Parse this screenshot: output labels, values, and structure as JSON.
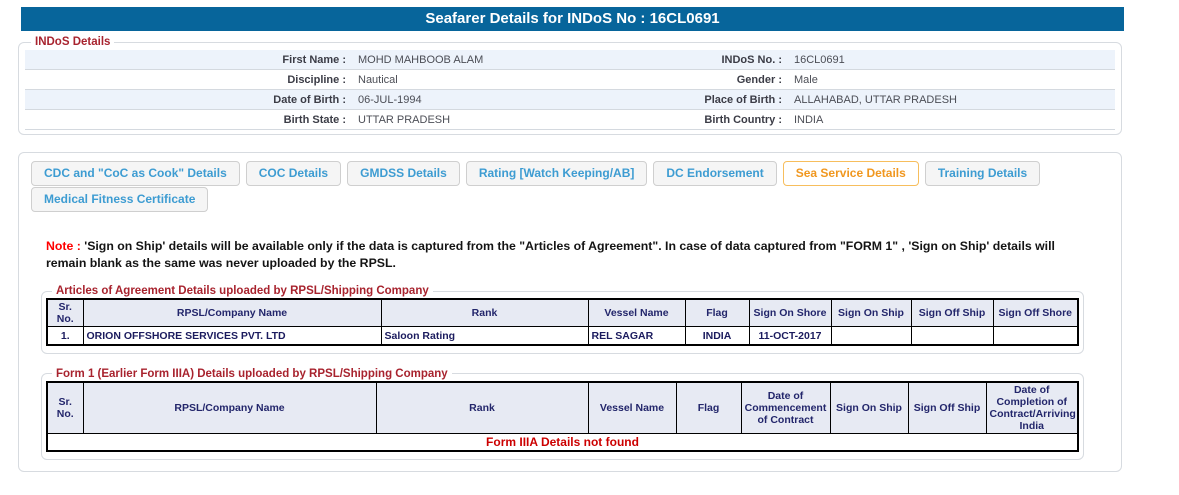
{
  "title": "Seafarer Details for INDoS No : 16CL0691",
  "indos_details": {
    "legend": "INDoS Details",
    "rows": [
      {
        "label1": "First Name :",
        "value1": "MOHD MAHBOOB ALAM",
        "label2": "INDoS No. :",
        "value2": "16CL0691"
      },
      {
        "label1": "Discipline :",
        "value1": "Nautical",
        "label2": "Gender :",
        "value2": "Male"
      },
      {
        "label1": "Date of Birth :",
        "value1": "06-JUL-1994",
        "label2": "Place of Birth :",
        "value2": "ALLAHABAD, UTTAR PRADESH"
      },
      {
        "label1": "Birth State :",
        "value1": "UTTAR PRADESH",
        "label2": "Birth Country :",
        "value2": "INDIA"
      }
    ]
  },
  "tabs": [
    {
      "label": "CDC and \"CoC as Cook\" Details",
      "row": 1,
      "active": false
    },
    {
      "label": "COC Details",
      "row": 1,
      "active": false
    },
    {
      "label": "GMDSS Details",
      "row": 1,
      "active": false
    },
    {
      "label": "Rating [Watch Keeping/AB]",
      "row": 1,
      "active": false
    },
    {
      "label": "DC Endorsement",
      "row": 1,
      "active": false
    },
    {
      "label": "Sea Service Details",
      "row": 1,
      "active": true
    },
    {
      "label": "Training Details",
      "row": 1,
      "active": false
    },
    {
      "label": "Medical Fitness Certificate",
      "row": 2,
      "active": false
    }
  ],
  "note": {
    "prefix": "Note :",
    "text": "'Sign on Ship' details will be available only if the data is captured from the \"Articles of Agreement\". In case of data captured from \"FORM 1\" , 'Sign on Ship' details will remain blank as the same was never uploaded by the RPSL."
  },
  "articles_table": {
    "legend": "Articles of Agreement Details uploaded by RPSL/Shipping Company",
    "headers": [
      "Sr. No.",
      "RPSL/Company Name",
      "Rank",
      "Vessel Name",
      "Flag",
      "Sign On Shore",
      "Sign On Ship",
      "Sign Off Ship",
      "Sign Off Shore"
    ],
    "rows": [
      [
        "1.",
        "ORION OFFSHORE SERVICES PVT. LTD",
        "Saloon Rating",
        "REL SAGAR",
        "INDIA",
        "11-OCT-2017",
        "",
        "",
        ""
      ]
    ]
  },
  "form1_table": {
    "legend": "Form 1 (Earlier Form IIIA) Details uploaded by RPSL/Shipping Company",
    "headers": [
      "Sr. No.",
      "RPSL/Company Name",
      "Rank",
      "Vessel Name",
      "Flag",
      "Date of Commencement of Contract",
      "Sign On Ship",
      "Sign Off Ship",
      "Date of Completion of Contract/Arriving India"
    ],
    "rows": [],
    "empty_message": "Form IIIA Details not found"
  },
  "colors": {
    "titlebar_bg": "#07659B",
    "legend_red": "#A8232E",
    "note_red": "#FF0000",
    "tab_blue": "#3D9CD2",
    "tab_active_orange": "#F0971F",
    "tab_active_border": "#F7BE5D",
    "table_header_navy": "#23266B",
    "error_red": "#CC0000"
  }
}
